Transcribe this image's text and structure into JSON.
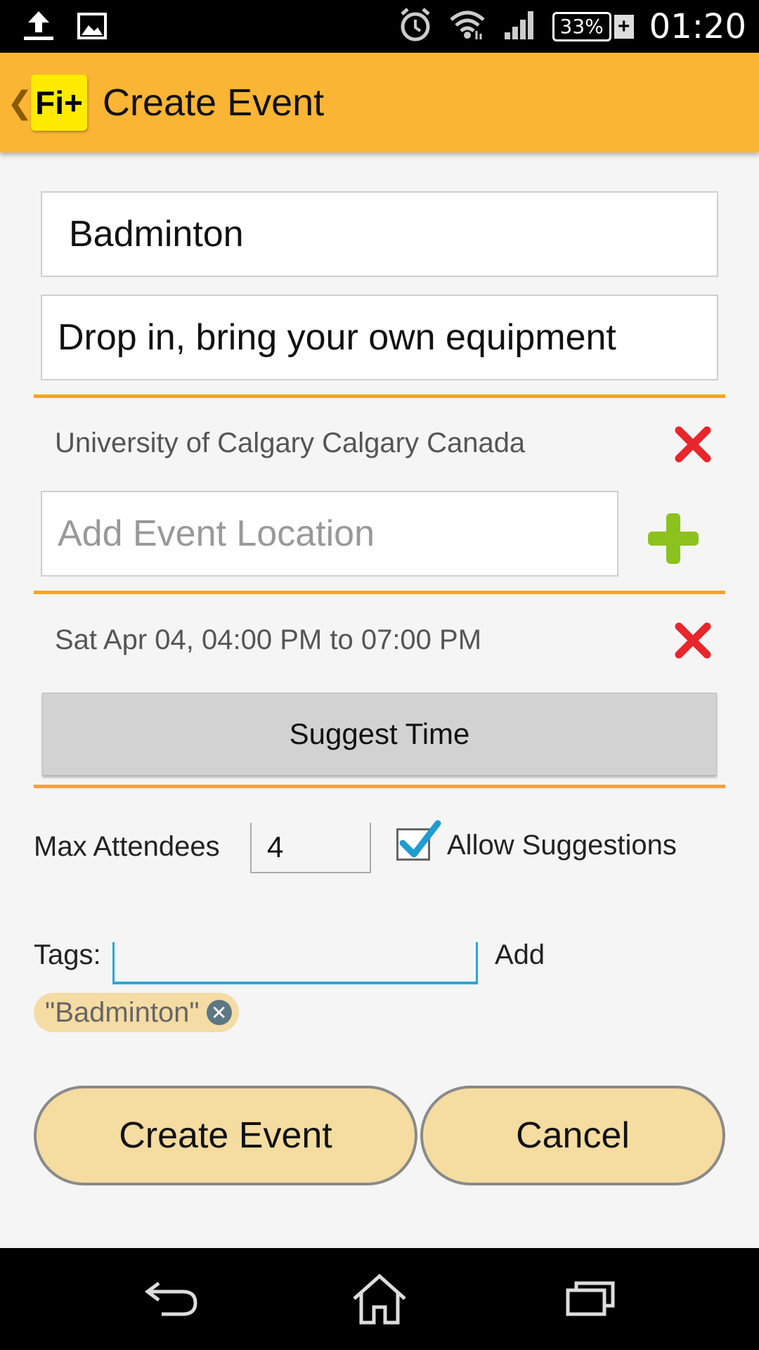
{
  "status_bar": {
    "time": "01:20",
    "battery": "33%",
    "icons": [
      "upload-icon",
      "image-icon",
      "alarm-icon",
      "wifi-icon",
      "signal-icon",
      "battery-icon"
    ]
  },
  "app_bar": {
    "logo": "Fi+",
    "title": "Create Event"
  },
  "form": {
    "event_name": "Badminton",
    "event_description": "Drop in, bring your own equipment",
    "location_added": "University of Calgary Calgary Canada",
    "location_placeholder": "Add Event Location",
    "time_added": "Sat Apr 04, 04:00 PM to 07:00 PM",
    "suggest_time_label": "Suggest Time",
    "max_attendees_label": "Max Attendees",
    "max_attendees_value": "4",
    "allow_suggestions_label": "Allow Suggestions",
    "allow_suggestions_checked": true,
    "tags_label": "Tags:",
    "tags_add_label": "Add",
    "tags": [
      "\"Badminton\""
    ]
  },
  "actions": {
    "create_label": "Create Event",
    "cancel_label": "Cancel"
  },
  "colors": {
    "app_bar": "#fbb534",
    "divider": "#f5a623",
    "remove_red": "#e8262b",
    "add_green": "#8cc21e",
    "tags_underline": "#2aa7d6",
    "button_fill": "#f5dca0"
  }
}
